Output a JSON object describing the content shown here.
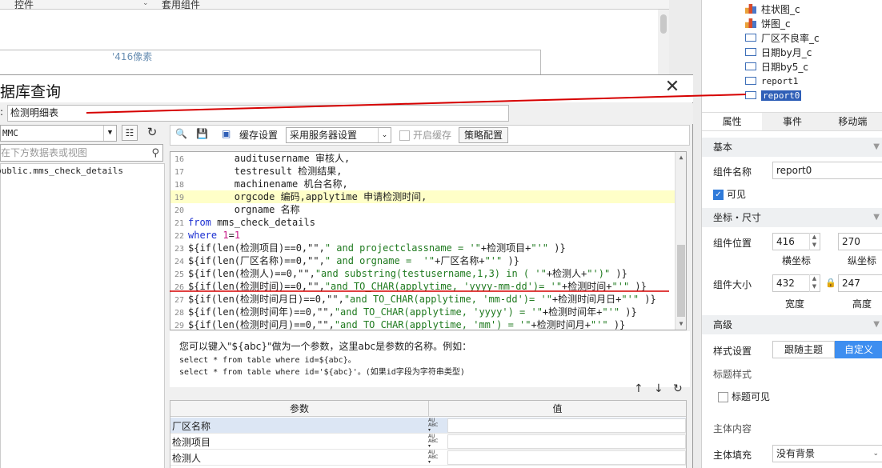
{
  "background": {
    "top_tabs": [
      "控件",
      "套用组件"
    ],
    "ruler_label": "'416像素"
  },
  "right_panel": {
    "tree": [
      {
        "label": "柱状图_c",
        "icon": "bar-chart-icon"
      },
      {
        "label": "饼图_c",
        "icon": "bar-chart-icon"
      },
      {
        "label": "厂区不良率_c",
        "icon": "report-icon"
      },
      {
        "label": "日期by月_c",
        "icon": "report-icon"
      },
      {
        "label": "日期by5_c",
        "icon": "report-icon"
      },
      {
        "label": "report1",
        "icon": "report-icon"
      },
      {
        "label": "report0",
        "icon": "report-icon",
        "selected": true
      }
    ],
    "tabs": [
      "属性",
      "事件",
      "移动端"
    ],
    "sections": {
      "basic": "基本",
      "coords": "坐标・尺寸",
      "advanced": "高级"
    },
    "component_name_label": "组件名称",
    "component_name_value": "report0",
    "visible_label": "可见",
    "position_label": "组件位置",
    "pos_x": "416",
    "pos_y": "270",
    "x_label": "横坐标",
    "y_label": "纵坐标",
    "size_label": "组件大小",
    "width": "432",
    "height": "247",
    "width_label": "宽度",
    "height_label": "高度",
    "style_label": "样式设置",
    "style_options": [
      "跟随主题",
      "自定义"
    ],
    "title_style_label": "标题样式",
    "title_visible_label": "标题可见",
    "body_content_label": "主体内容",
    "body_fill_label": "主体填充",
    "body_fill_value": "没有背景"
  },
  "dialog": {
    "title": "据库查询",
    "name_value": "检测明细表",
    "datasource": "MMC",
    "search_placeholder": "在下方数据表或视图",
    "tables": [
      "public.mms_check_details"
    ],
    "cache_label": "缓存设置",
    "cache_option": "采用服务器设置",
    "enable_cache_label": "开启缓存",
    "strategy_button": "策略配置",
    "help_line1": "您可以键入\"${abc}\"做为一个参数，这里abc是参数的名称。例如：",
    "help_line2": "select * from table where id=${abc}。",
    "help_line3": "select * from table where id='${abc}'。(如果id字段为字符串类型)",
    "param_header": "参数",
    "value_header": "值",
    "params": [
      "厂区名称",
      "检测项目",
      "检测人"
    ]
  },
  "colors": {
    "accent": "#2f5fb7",
    "highlight_line": "#ffffc8",
    "annotation": "#d60000"
  }
}
